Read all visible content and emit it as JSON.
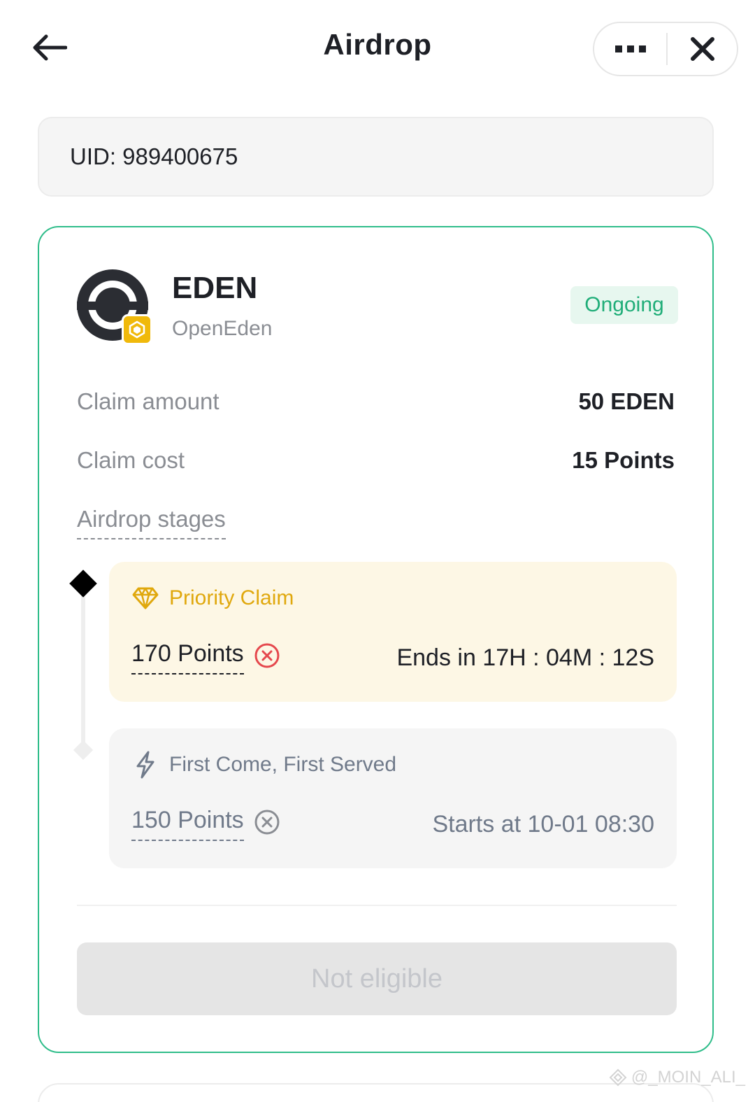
{
  "header": {
    "title": "Airdrop",
    "back_icon": "arrow-left-icon",
    "more_icon": "more-dots-icon",
    "close_icon": "close-icon"
  },
  "uid": {
    "text": "UID: 989400675"
  },
  "airdrop": {
    "token": "EDEN",
    "project": "OpenEden",
    "status": "Ongoing",
    "claim_amount_label": "Claim amount",
    "claim_amount_value": "50 EDEN",
    "claim_cost_label": "Claim cost",
    "claim_cost_value": "15 Points",
    "stages_label": "Airdrop stages",
    "stages": [
      {
        "title": "Priority Claim",
        "points": "170 Points",
        "time": "Ends in 17H : 04M : 12S",
        "icon": "diamond-icon",
        "active": true
      },
      {
        "title": "First Come, First Served",
        "points": "150 Points",
        "time": "Starts at 10-01 08:30",
        "icon": "lightning-icon",
        "active": false
      }
    ],
    "action_label": "Not eligible"
  },
  "watermark": "@_MOIN_ALI_",
  "colors": {
    "accent_green": "#2fbd8a",
    "status_green": "#1fad78",
    "gold": "#e0a80d",
    "error_red": "#e5484d"
  }
}
